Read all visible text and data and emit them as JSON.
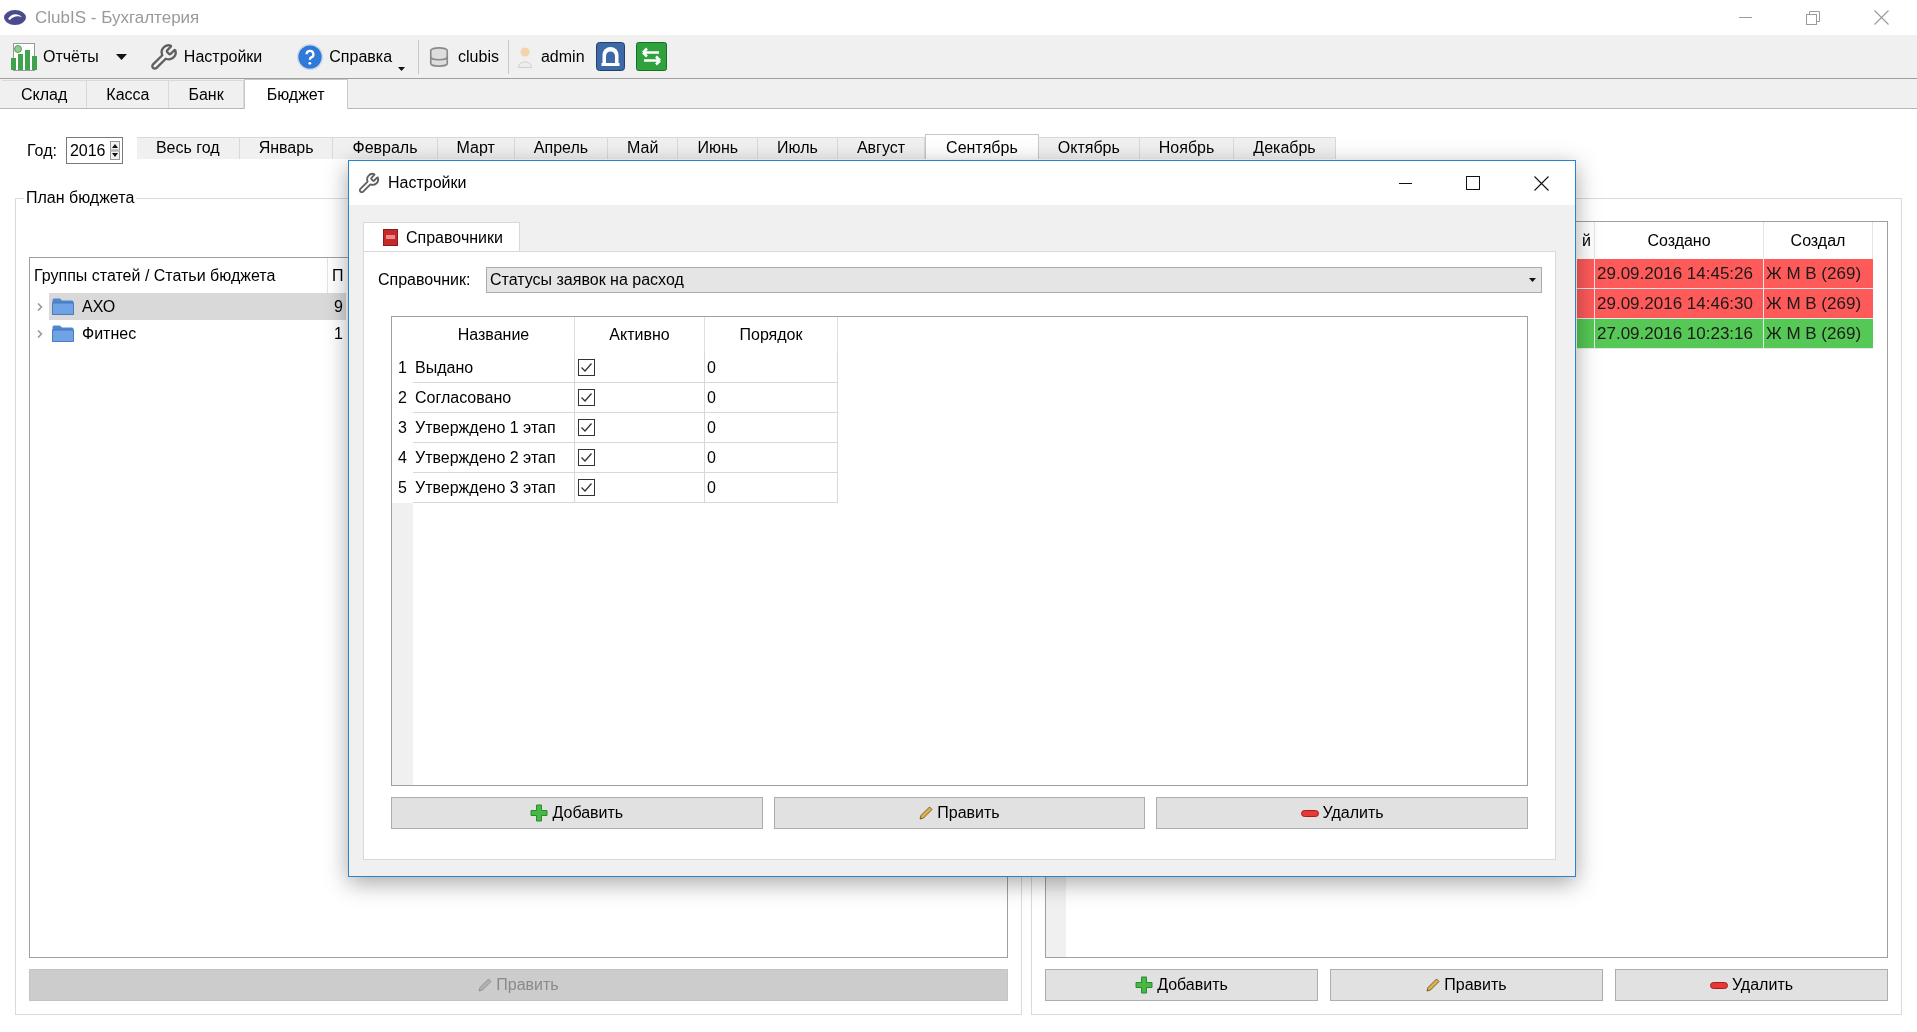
{
  "window": {
    "title": "ClubIS - Бухгалтерия"
  },
  "toolbar": {
    "groups": [
      {
        "items": [
          {
            "kind": "reports",
            "label": "Отчёты"
          },
          {
            "kind": "settings",
            "label": "Настройки"
          },
          {
            "kind": "help",
            "label": "Справка"
          }
        ]
      },
      {
        "items": [
          {
            "kind": "database",
            "label": "clubis"
          }
        ]
      },
      {
        "items": [
          {
            "kind": "user",
            "label": "admin"
          },
          {
            "kind": "lock"
          },
          {
            "kind": "exit"
          }
        ]
      }
    ]
  },
  "tabs": [
    {
      "label": "Склад",
      "selected": false
    },
    {
      "label": "Касса",
      "selected": false
    },
    {
      "label": "Банк",
      "selected": false
    },
    {
      "label": "Бюджет",
      "selected": true
    }
  ],
  "budget": {
    "year": {
      "label": "Год:",
      "value": "2016"
    },
    "months": [
      {
        "label": "Весь год",
        "selected": false
      },
      {
        "label": "Январь",
        "selected": false
      },
      {
        "label": "Февраль",
        "selected": false
      },
      {
        "label": "Март",
        "selected": false
      },
      {
        "label": "Апрель",
        "selected": false
      },
      {
        "label": "Май",
        "selected": false
      },
      {
        "label": "Июнь",
        "selected": false
      },
      {
        "label": "Июль",
        "selected": false
      },
      {
        "label": "Август",
        "selected": false
      },
      {
        "label": "Сентябрь",
        "selected": true
      },
      {
        "label": "Октябрь",
        "selected": false
      },
      {
        "label": "Ноябрь",
        "selected": false
      },
      {
        "label": "Декабрь",
        "selected": false
      }
    ]
  },
  "plan": {
    "title": "План бюджета",
    "tree": {
      "columns": [
        "Группы статей / Статьи бюджета",
        "П"
      ],
      "rows": [
        {
          "name": "АХО",
          "column_2": "9",
          "expanded": false,
          "selected": true
        },
        {
          "name": "Фитнес",
          "column_2": "1",
          "expanded": false,
          "selected": false
        }
      ]
    },
    "buttons": [
      {
        "kind": "edit",
        "label": "Править",
        "disabled": true
      }
    ]
  },
  "requests": {
    "table": {
      "columns": [
        "й",
        "Создано",
        "Создал"
      ],
      "rows": [
        {
          "color": "#ff5a5a",
          "created": "29.09.2016 14:45:26",
          "created_by": "Ж М В (269)"
        },
        {
          "color": "#ff5a5a",
          "created": "29.09.2016 14:46:30",
          "created_by": "Ж М В (269)"
        },
        {
          "color": "#55c855",
          "created": "27.09.2016 10:23:16",
          "created_by": "Ж М В (269)"
        }
      ]
    },
    "buttons": [
      {
        "kind": "add",
        "label": "Добавить",
        "disabled": false
      },
      {
        "kind": "edit",
        "label": "Править",
        "disabled": false
      },
      {
        "kind": "delete",
        "label": "Удалить",
        "disabled": false
      }
    ]
  },
  "dialog": {
    "title": "Настройки",
    "tabs": [
      {
        "label": "Справочники",
        "selected": true
      }
    ],
    "reference": {
      "label": "Справочник:",
      "value": "Статусы заявок на расход"
    },
    "table": {
      "columns": [
        "Название",
        "Активно",
        "Порядок"
      ],
      "rows": [
        {
          "number": "1",
          "name": "Выдано",
          "active": true,
          "order": "0"
        },
        {
          "number": "2",
          "name": "Согласовано",
          "active": true,
          "order": "0"
        },
        {
          "number": "3",
          "name": "Утверждено 1 этап",
          "active": true,
          "order": "0"
        },
        {
          "number": "4",
          "name": "Утверждено 2 этап",
          "active": true,
          "order": "0"
        },
        {
          "number": "5",
          "name": "Утверждено 3 этап",
          "active": true,
          "order": "0"
        }
      ]
    },
    "buttons": [
      {
        "kind": "add",
        "label": "Добавить"
      },
      {
        "kind": "edit",
        "label": "Править"
      },
      {
        "kind": "delete",
        "label": "Удалить"
      }
    ]
  }
}
